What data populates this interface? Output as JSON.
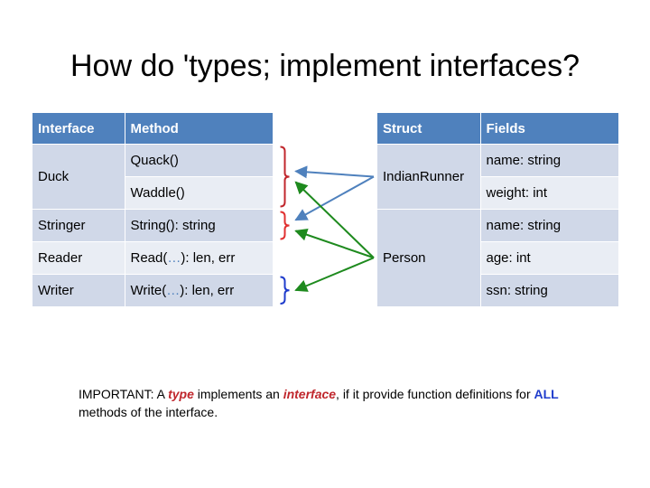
{
  "title": "How do 'types; implement interfaces?",
  "interface_table": {
    "headers": [
      "Interface",
      "Method"
    ],
    "groups": [
      {
        "name": "Duck",
        "methods": [
          {
            "pre": "Quack()",
            "ellipsis": "",
            "post": ""
          },
          {
            "pre": "Waddle()",
            "ellipsis": "",
            "post": ""
          }
        ]
      },
      {
        "name": "Stringer",
        "methods": [
          {
            "pre": "String(): string",
            "ellipsis": "",
            "post": ""
          }
        ]
      },
      {
        "name": "Reader",
        "methods": [
          {
            "pre": "Read(",
            "ellipsis": "…",
            "post": "): len, err"
          }
        ]
      },
      {
        "name": "Writer",
        "methods": [
          {
            "pre": "Write(",
            "ellipsis": "…",
            "post": "): len, err"
          }
        ]
      }
    ]
  },
  "struct_table": {
    "headers": [
      "Struct",
      "Fields"
    ],
    "groups": [
      {
        "name": "IndianRunner",
        "fields": [
          "name: string",
          "weight: int"
        ]
      },
      {
        "name": "Person",
        "fields": [
          "name: string",
          "age: int",
          "ssn: string"
        ]
      }
    ]
  },
  "connections": [
    {
      "from": "IndianRunner",
      "to": "Duck",
      "color": "#4f81bd"
    },
    {
      "from": "IndianRunner",
      "to": "Stringer",
      "color": "#4f81bd"
    },
    {
      "from": "Person",
      "to": "Duck",
      "color": "#1e8a1e"
    },
    {
      "from": "Person",
      "to": "Stringer",
      "color": "#1e8a1e"
    },
    {
      "from": "Person",
      "to": "Writer",
      "color": "#1e8a1e"
    }
  ],
  "brackets": [
    {
      "interface": "Duck",
      "color": "#c0272d"
    },
    {
      "interface": "Stringer",
      "color": "#e03030"
    },
    {
      "interface": "Writer",
      "color": "#1f3ccc"
    }
  ],
  "note": {
    "p1": "IMPORTANT: A ",
    "em1": "type",
    "p2": " implements an ",
    "em2": "interface",
    "p3": ", if it provide function definitions for ",
    "em3": "ALL",
    "p4": " methods of the interface."
  }
}
